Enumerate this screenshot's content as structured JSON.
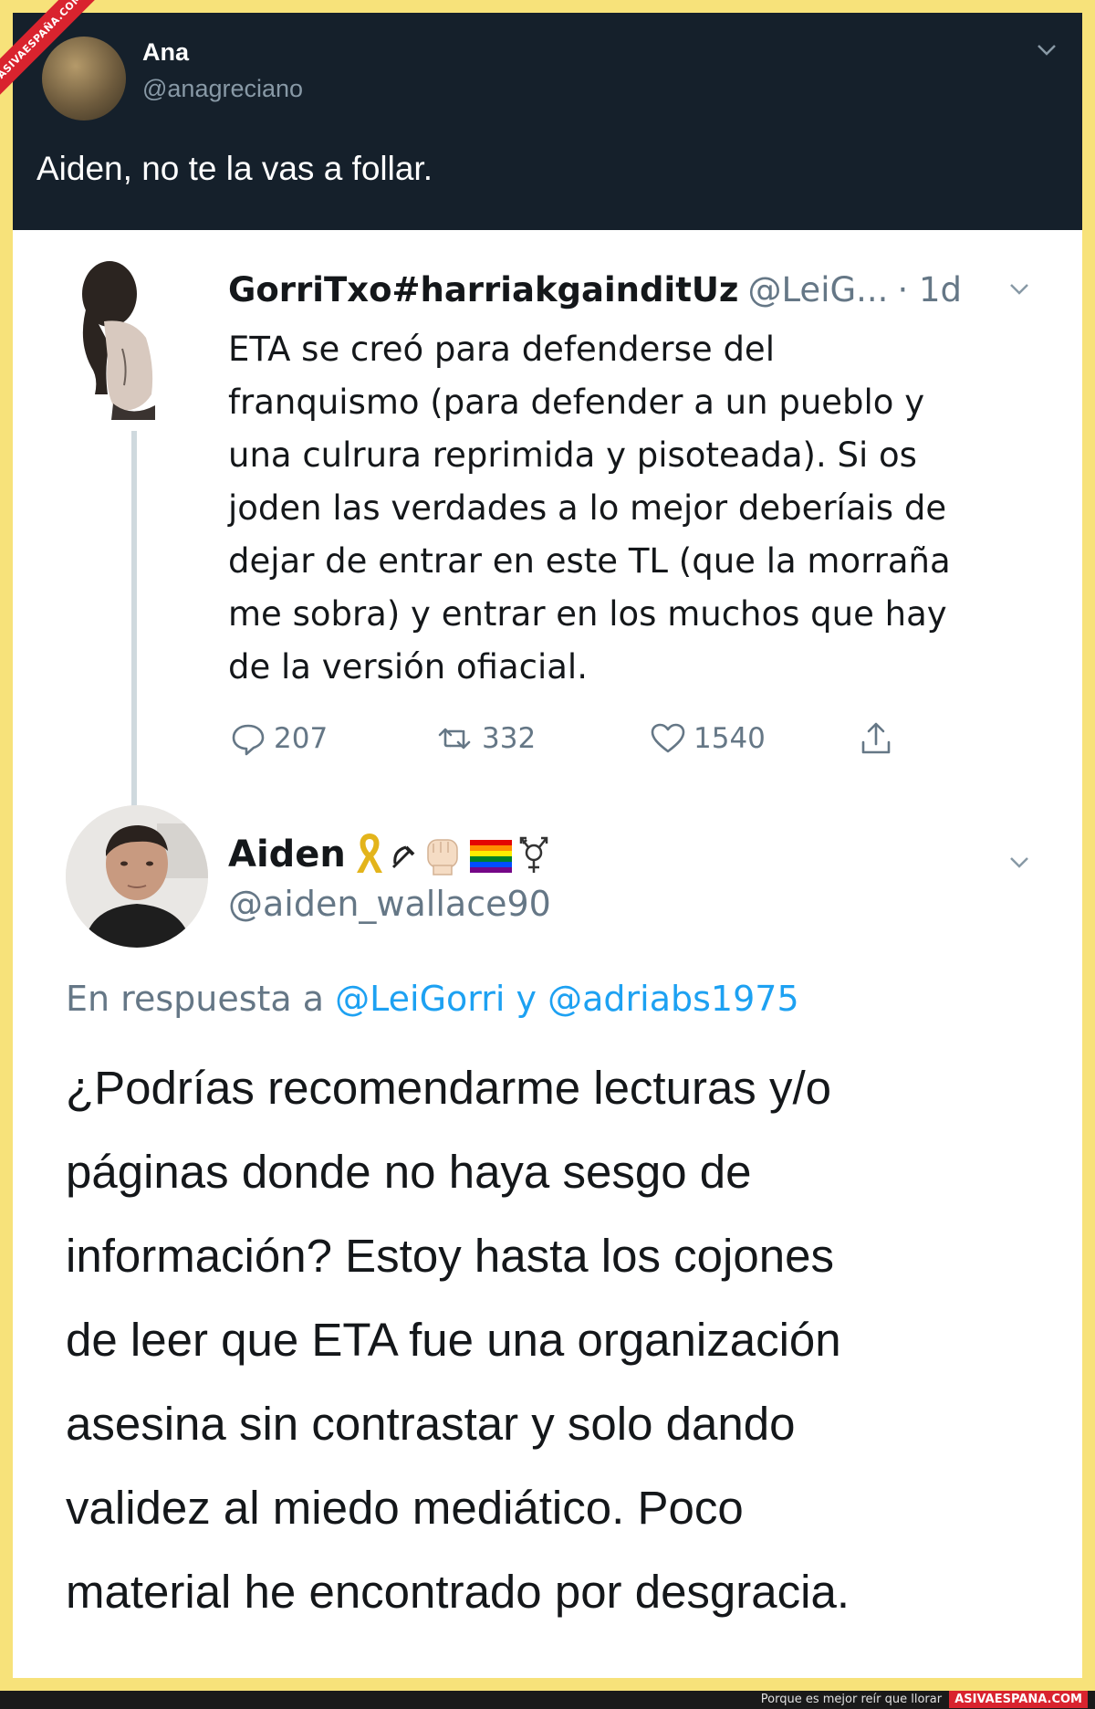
{
  "top_tweet": {
    "name": "Ana",
    "handle": "@anagreciano",
    "text": "Aiden, no te la vas a follar."
  },
  "watermark": {
    "ribbon_text": "ASIVAESPAÑA.COM"
  },
  "tweet_gorri": {
    "name": "GorriTxo#harriakgainditUz",
    "handle": "@LeiG...",
    "time": "· 1d",
    "text_lines": [
      "ETA se creó para defenderse del",
      "franquismo (para defender a un pueblo y",
      "una culrura reprimida y pisoteada). Si os",
      "joden las verdades a lo mejor deberíais de",
      "dejar de entrar en este TL (que la morraña",
      "me sobra) y entrar en los muchos que hay",
      "de la versión ofiacial."
    ],
    "replies": "207",
    "retweets": "332",
    "likes": "1540"
  },
  "tweet_aiden": {
    "name": "Aiden",
    "emojis": [
      "ribbon-icon",
      "hammer-sickle-icon",
      "raised-fist-icon",
      "rainbow-flag-icon",
      "transgender-symbol-icon"
    ],
    "handle": "@aiden_wallace90",
    "reply_prefix": "En respuesta a",
    "reply_mention_1": "@LeiGorri",
    "reply_and": "y",
    "reply_mention_2": "@adriabs1975",
    "text_lines": [
      "¿Podrías recomendarme lecturas y/o",
      "páginas donde no haya sesgo de",
      "información? Estoy hasta los cojones",
      "de leer que ETA fue una organización",
      "asesina sin contrastar y solo dando",
      "validez al miedo mediático. Poco",
      "material he encontrado por desgracia."
    ]
  },
  "footer": {
    "tagline": "Porque es mejor reír que llorar",
    "brand": "ASIVAESPANA.COM"
  },
  "colors": {
    "border_yellow": "#f7e27a",
    "dark_bg": "#15202b",
    "link_blue": "#1da1f2",
    "muted_gray": "#657786",
    "watermark_red": "#d9232e"
  }
}
